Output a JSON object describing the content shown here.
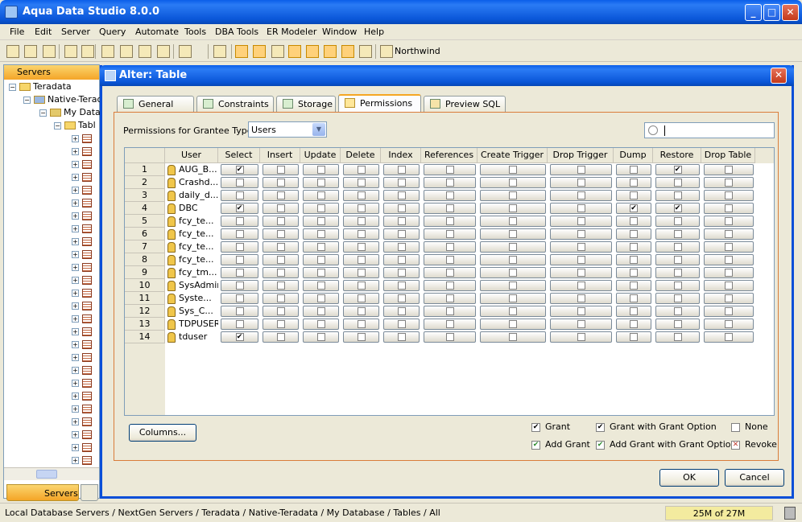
{
  "app": {
    "title": "Aqua Data Studio 8.0.0"
  },
  "menu": [
    "File",
    "Edit",
    "Server",
    "Query",
    "Automate",
    "Tools",
    "DBA Tools",
    "ER Modeler",
    "Window",
    "Help"
  ],
  "toolbar": {
    "server_label": "Northwind"
  },
  "servers_panel": {
    "title": "Servers",
    "tree": [
      "Teradata",
      "Native-Terad",
      "My Data",
      "Tabl"
    ],
    "bottom_tab": "Servers"
  },
  "status": {
    "path": "Local Database Servers / NextGen Servers / Teradata / Native-Teradata / My Database / Tables / All",
    "memory": "25M of 27M"
  },
  "dialog": {
    "title": "Alter: Table",
    "tabs": [
      "General",
      "Constraints",
      "Storage",
      "Permissions",
      "Preview SQL"
    ],
    "active_tab": "Permissions",
    "grantee_label": "Permissions for Grantee Type:",
    "grantee_value": "Users",
    "columns": [
      "User",
      "Select",
      "Insert",
      "Update",
      "Delete",
      "Index",
      "References",
      "Create Trigger",
      "Drop Trigger",
      "Dump",
      "Restore",
      "Drop Table"
    ],
    "rows": [
      {
        "num": "1",
        "user": "AUG_B...",
        "perms": [
          "grant",
          "",
          "",
          "",
          "",
          "",
          "",
          "",
          "",
          "grant",
          ""
        ]
      },
      {
        "num": "2",
        "user": "Crashd...",
        "perms": [
          "",
          "",
          "",
          "",
          "",
          "",
          "",
          "",
          "",
          "",
          ""
        ]
      },
      {
        "num": "3",
        "user": "daily_d...",
        "perms": [
          "",
          "",
          "",
          "",
          "",
          "",
          "",
          "",
          "",
          "",
          ""
        ]
      },
      {
        "num": "4",
        "user": "DBC",
        "perms": [
          "grant_option",
          "",
          "",
          "",
          "",
          "",
          "",
          "",
          "grant_option",
          "grant_option",
          ""
        ]
      },
      {
        "num": "5",
        "user": "fcy_te...",
        "perms": [
          "",
          "",
          "",
          "",
          "",
          "",
          "",
          "",
          "",
          "",
          ""
        ]
      },
      {
        "num": "6",
        "user": "fcy_te...",
        "perms": [
          "",
          "",
          "",
          "",
          "",
          "",
          "",
          "",
          "",
          "",
          ""
        ]
      },
      {
        "num": "7",
        "user": "fcy_te...",
        "perms": [
          "",
          "",
          "",
          "",
          "",
          "",
          "",
          "",
          "",
          "",
          ""
        ]
      },
      {
        "num": "8",
        "user": "fcy_te...",
        "perms": [
          "",
          "",
          "",
          "",
          "",
          "",
          "",
          "",
          "",
          "",
          ""
        ]
      },
      {
        "num": "9",
        "user": "fcy_tm...",
        "perms": [
          "",
          "",
          "",
          "",
          "",
          "",
          "",
          "",
          "",
          "",
          ""
        ]
      },
      {
        "num": "10",
        "user": "SysAdmin",
        "perms": [
          "",
          "",
          "",
          "",
          "",
          "",
          "",
          "",
          "",
          "",
          ""
        ]
      },
      {
        "num": "11",
        "user": "Syste...",
        "perms": [
          "",
          "",
          "",
          "",
          "",
          "",
          "",
          "",
          "",
          "",
          ""
        ]
      },
      {
        "num": "12",
        "user": "Sys_C...",
        "perms": [
          "",
          "",
          "",
          "",
          "",
          "",
          "",
          "",
          "",
          "",
          ""
        ]
      },
      {
        "num": "13",
        "user": "TDPUSER",
        "perms": [
          "",
          "",
          "",
          "",
          "",
          "",
          "",
          "",
          "",
          "",
          ""
        ]
      },
      {
        "num": "14",
        "user": "tduser",
        "perms": [
          "grant",
          "",
          "",
          "",
          "",
          "",
          "",
          "",
          "",
          "",
          ""
        ]
      }
    ],
    "legend": {
      "grant": "Grant",
      "grant_option": "Grant with Grant Option",
      "none": "None",
      "add_grant": "Add Grant",
      "add_grant_option": "Add Grant with Grant Option",
      "revoke": "Revoke"
    },
    "columns_button": "Columns...",
    "ok_button": "OK",
    "cancel_button": "Cancel"
  },
  "colors": {
    "title_blue": "#0a56d8",
    "tab_accent": "#f5a623",
    "pane_border": "#d97c3a",
    "revoke_red": "#c0392b",
    "add_green": "#2e8b2e"
  }
}
